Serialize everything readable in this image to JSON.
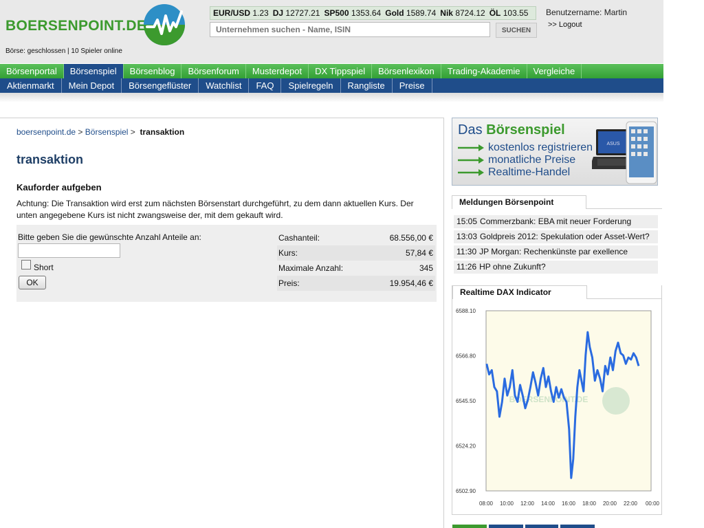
{
  "header": {
    "logo_text": "BOERSENPOINT.DE",
    "market_status": "Börse: geschlossen | 10 Spieler online",
    "ticker": [
      {
        "name": "EUR/USD",
        "value": "1.23"
      },
      {
        "name": "DJ",
        "value": "12727.21"
      },
      {
        "name": "SP500",
        "value": "1353.64"
      },
      {
        "name": "Gold",
        "value": "1589.74"
      },
      {
        "name": "Nik",
        "value": "8724.12"
      },
      {
        "name": "ÖL",
        "value": "103.55"
      }
    ],
    "search_placeholder": "Unternehmen suchen - Name, ISIN",
    "search_button": "SUCHEN",
    "username": "Benutzername: Martin",
    "logout": ">> Logout"
  },
  "nav": {
    "main": [
      "Börsenportal",
      "Börsenspiel",
      "Börsenblog",
      "Börsenforum",
      "Musterdepot",
      "DX Tippspiel",
      "Börsenlexikon",
      "Trading-Akademie",
      "Vergleiche"
    ],
    "main_active": "Börsenspiel",
    "sub": [
      "Aktienmarkt",
      "Mein Depot",
      "Börsengeflüster",
      "Watchlist",
      "FAQ",
      "Spielregeln",
      "Rangliste",
      "Preise"
    ]
  },
  "breadcrumb": {
    "home": "boersenpoint.de",
    "section": "Börsenspiel",
    "current": "transaktion"
  },
  "main": {
    "title": "transaktion",
    "section_title": "Kauforder aufgeben",
    "notice": "Achtung: Die Transaktion wird erst zum nächsten Börsenstart durchgeführt, zu dem dann aktuellen Kurs. Der unten angegebene Kurs ist nicht zwangsweise der, mit dem gekauft wird.",
    "order": {
      "shares_label": "Bitte geben Sie die gewünschte Anzahl Anteile an:",
      "shares_value": "",
      "short_label": "Short",
      "short_checked": false,
      "ok_label": "OK"
    },
    "summary": [
      {
        "label": "Cashanteil:",
        "value": "68.556,00 €"
      },
      {
        "label": "Kurs:",
        "value": "57,84 €"
      },
      {
        "label": "Maximale Anzahl:",
        "value": "345"
      },
      {
        "label": "Preis:",
        "value": "19.954,46 €"
      }
    ]
  },
  "sidebar": {
    "promo": {
      "title_prefix": "Das",
      "title_highlight": "Börsenspiel",
      "lines": [
        "kostenlos registrieren",
        "monatliche Preise",
        "Realtime-Handel"
      ],
      "laptop_brand": "ASUS"
    },
    "news": {
      "heading": "Meldungen Börsenpoint",
      "items": [
        {
          "time": "15:05",
          "text": "Commerzbank: EBA mit neuer Forderung"
        },
        {
          "time": "13:03",
          "text": "Goldpreis 2012: Spekulation oder Asset-Wert?"
        },
        {
          "time": "11:30",
          "text": "JP Morgan: Rechenkünste par exellence"
        },
        {
          "time": "11:26",
          "text": "HP ohne Zukunft?"
        }
      ]
    },
    "dax": {
      "heading": "Realtime DAX Indicator",
      "watermark": "BOERSENPOINT.DE"
    }
  },
  "colors": {
    "brand_green": "#3c9a2e",
    "nav_blue": "#1f4d8a",
    "chart_line": "#2a6be0"
  },
  "chart_data": {
    "type": "line",
    "title": "",
    "xlabel": "",
    "ylabel": "",
    "x_ticks": [
      "08:00",
      "10:00",
      "12:00",
      "14:00",
      "16:00",
      "18:00",
      "20:00",
      "22:00",
      "00:00"
    ],
    "y_ticks": [
      6588.1,
      6566.8,
      6545.5,
      6524.2,
      6502.9
    ],
    "ylim": [
      6502.9,
      6588.1
    ],
    "xlim_hours": [
      8,
      24
    ],
    "grid": false,
    "series": [
      {
        "x": [
          8.0,
          8.25,
          8.5,
          8.75,
          9.0,
          9.25,
          9.5,
          9.75,
          10.0,
          10.25,
          10.5,
          10.75,
          11.0,
          11.25,
          11.5,
          11.75,
          12.0,
          12.25,
          12.5,
          12.75,
          13.0,
          13.25,
          13.5,
          13.75,
          14.0,
          14.25,
          14.5,
          14.75,
          15.0,
          15.25,
          15.5,
          15.75,
          16.0,
          16.2,
          16.4,
          16.6,
          16.8,
          17.0,
          17.2,
          17.4,
          17.6,
          17.8,
          18.0,
          18.25,
          18.5,
          18.75,
          19.0,
          19.25,
          19.5,
          19.75,
          20.0,
          20.25,
          20.5,
          20.75,
          21.0,
          21.25,
          21.5,
          21.75,
          22.0,
          22.25,
          22.5,
          22.75
        ],
        "values": [
          6563,
          6558,
          6560,
          6552,
          6550,
          6538,
          6545,
          6556,
          6548,
          6552,
          6560,
          6548,
          6545,
          6553,
          6548,
          6542,
          6546,
          6552,
          6559,
          6554,
          6548,
          6556,
          6561,
          6552,
          6557,
          6550,
          6545,
          6552,
          6547,
          6551,
          6547,
          6545,
          6532,
          6509,
          6518,
          6538,
          6552,
          6560,
          6555,
          6550,
          6567,
          6578,
          6571,
          6566,
          6555,
          6560,
          6556,
          6550,
          6562,
          6558,
          6566,
          6560,
          6569,
          6573,
          6568,
          6567,
          6563,
          6566,
          6565,
          6568,
          6566,
          6562
        ]
      }
    ]
  }
}
